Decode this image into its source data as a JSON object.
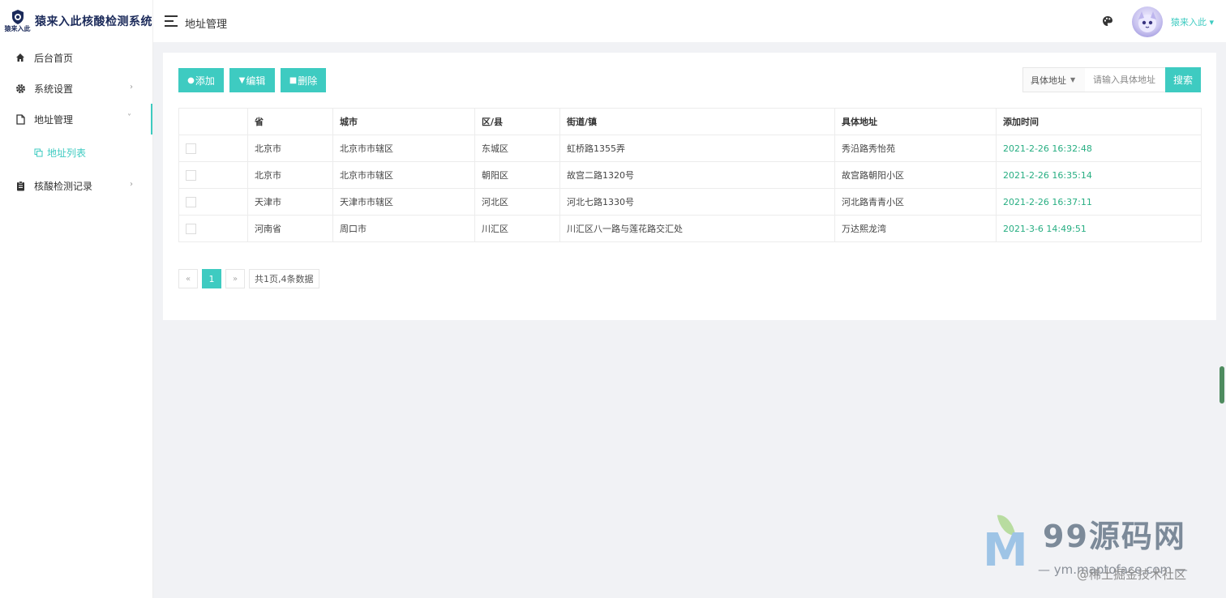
{
  "app": {
    "logo_mark_text": "猿来入此",
    "title": "猿来入此核酸检测系统"
  },
  "sidebar": {
    "items": [
      {
        "label": "后台首页",
        "icon": "home-icon"
      },
      {
        "label": "系统设置",
        "icon": "gear-icon",
        "arrow": "›"
      },
      {
        "label": "地址管理",
        "icon": "file-icon",
        "arrow": "˅"
      },
      {
        "label": "核酸检测记录",
        "icon": "clipboard-icon",
        "arrow": "›"
      }
    ],
    "sub_items": [
      {
        "label": "地址列表",
        "icon": "copy-icon"
      }
    ]
  },
  "header": {
    "title": "地址管理",
    "user_name": "猿来入此 ▾"
  },
  "toolbar": {
    "add_label": "添加",
    "edit_label": "编辑",
    "delete_label": "删除",
    "search_field": "具体地址",
    "search_placeholder": "请输入具体地址",
    "search_label": "搜索"
  },
  "table": {
    "columns": [
      "",
      "省",
      "城市",
      "区/县",
      "街道/镇",
      "具体地址",
      "添加时间"
    ],
    "rows": [
      {
        "province": "北京市",
        "city": "北京市市辖区",
        "district": "东城区",
        "street": "虹桥路1355弄",
        "address": "秀沿路秀怡苑",
        "time": "2021-2-26 16:32:48"
      },
      {
        "province": "北京市",
        "city": "北京市市辖区",
        "district": "朝阳区",
        "street": "故宫二路1320号",
        "address": "故宫路朝阳小区",
        "time": "2021-2-26 16:35:14"
      },
      {
        "province": "天津市",
        "city": "天津市市辖区",
        "district": "河北区",
        "street": "河北七路1330号",
        "address": "河北路青青小区",
        "time": "2021-2-26 16:37:11"
      },
      {
        "province": "河南省",
        "city": "周口市",
        "district": "川汇区",
        "street": "川汇区八一路与莲花路交汇处",
        "address": "万达熙龙湾",
        "time": "2021-3-6 14:49:51"
      }
    ]
  },
  "pagination": {
    "prev": "«",
    "current": "1",
    "next": "»",
    "info": "共1页,4条数据"
  },
  "watermark": {
    "logo_letter": "M",
    "title": "99源码网",
    "subtitle": "— ym.maptoface.com —",
    "credit": "@稀土掘金技术社区"
  },
  "colors": {
    "accent": "#3ecbc1",
    "time_text": "#27ae82",
    "brand_dark": "#1b2a5a"
  }
}
